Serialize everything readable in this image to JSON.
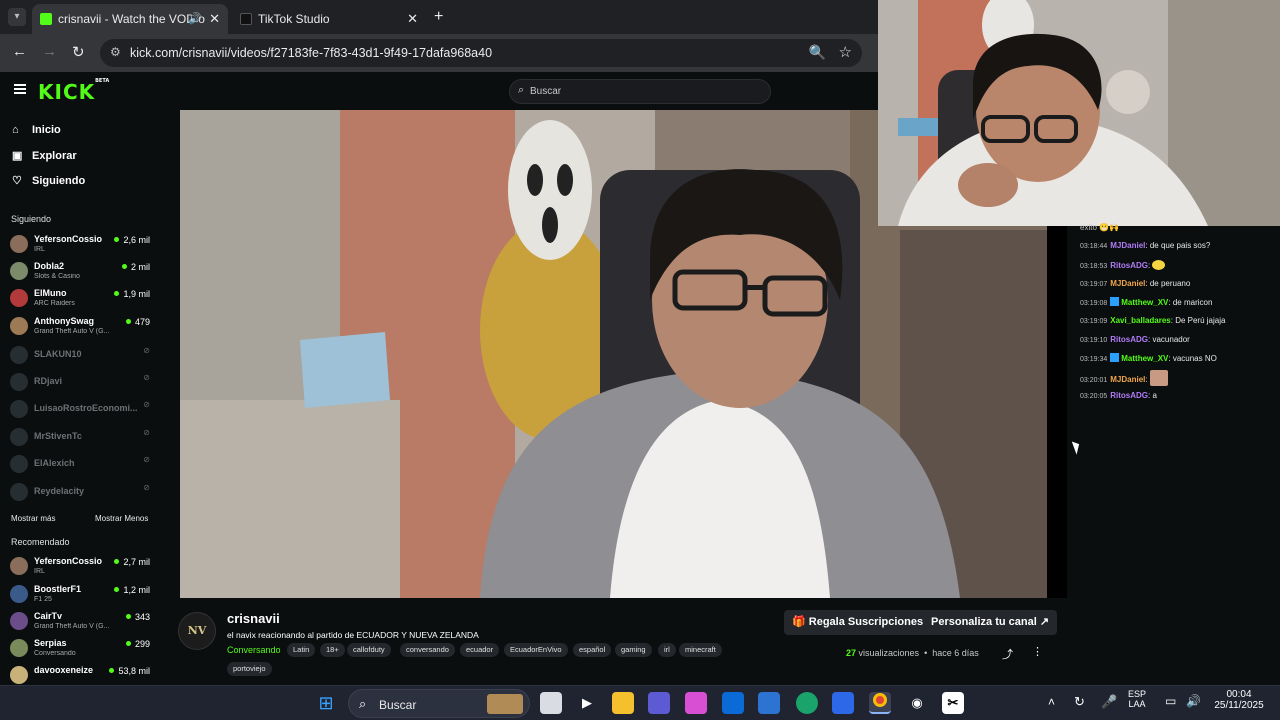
{
  "browser": {
    "tabs": [
      {
        "title": "crisnavii - Watch the VOD o",
        "active": true
      },
      {
        "title": "TikTok Studio",
        "active": false
      }
    ],
    "url": "kick.com/crisnavii/videos/f27183fe-7f83-43d1-9f49-17dafa968a40"
  },
  "header": {
    "logo": "KICK",
    "logo_badge": "BETA",
    "search_placeholder": "Buscar"
  },
  "sidebar": {
    "nav": [
      {
        "label": "Inicio",
        "icon": "home-icon"
      },
      {
        "label": "Explorar",
        "icon": "explore-icon"
      },
      {
        "label": "Siguiendo",
        "icon": "heart-icon"
      }
    ],
    "following_title": "Siguiendo",
    "following": [
      {
        "name": "YefersonCossio",
        "category": "IRL",
        "viewers": "2,6 mil",
        "live": true
      },
      {
        "name": "Dobla2",
        "category": "Slots & Casino",
        "viewers": "2 mil",
        "live": true
      },
      {
        "name": "ElMuno",
        "category": "ARC Raiders",
        "viewers": "1,9 mil",
        "live": true
      },
      {
        "name": "AnthonySwag",
        "category": "Grand Theft Auto V (G...",
        "viewers": "479",
        "live": true
      },
      {
        "name": "SLAKUN10",
        "live": false
      },
      {
        "name": "RDjavi",
        "live": false
      },
      {
        "name": "LuisaoRostroEconomi...",
        "live": false
      },
      {
        "name": "MrStivenTc",
        "live": false
      },
      {
        "name": "ElAlexich",
        "live": false
      },
      {
        "name": "Reydelacity",
        "live": false
      }
    ],
    "show_more": "Mostrar más",
    "show_less": "Mostrar Menos",
    "recommended_title": "Recomendado",
    "recommended": [
      {
        "name": "YefersonCossio",
        "category": "IRL",
        "viewers": "2,7 mil"
      },
      {
        "name": "BoostlerF1",
        "category": "F1 25",
        "viewers": "1,2 mil"
      },
      {
        "name": "CairTv",
        "category": "Grand Theft Auto V (G...",
        "viewers": "343"
      },
      {
        "name": "Serpias",
        "category": "Conversando",
        "viewers": "299"
      },
      {
        "name": "davooxeneize",
        "category": "",
        "viewers": "53,8 mil"
      }
    ]
  },
  "chat": {
    "partial_top": "exito",
    "messages": [
      {
        "time": "03:18:44",
        "user": "MJDaniel",
        "text": "de que pais sos?",
        "color": "#b07cf7"
      },
      {
        "time": "03:18:53",
        "user": "RitosADG",
        "text": "",
        "color": "#b07cf7",
        "emote": true
      },
      {
        "time": "03:19:07",
        "user": "MJDaniel",
        "text": "de peruano",
        "color": "#f2a54a"
      },
      {
        "time": "03:19:08",
        "user": "Matthew_XV",
        "text": "de maricon",
        "color": "#53fc18",
        "badge": true
      },
      {
        "time": "03:19:09",
        "user": "Xavi_balladares",
        "text": "De Perú jajaja",
        "color": "#53fc18"
      },
      {
        "time": "03:19:10",
        "user": "RitosADG",
        "text": "vacunador",
        "color": "#b07cf7"
      },
      {
        "time": "03:19:34",
        "user": "Matthew_XV",
        "text": "vacunas NO",
        "color": "#53fc18",
        "badge": true
      },
      {
        "time": "03:20:01",
        "user": "MJDaniel",
        "text": "",
        "color": "#f2a54a",
        "image": true
      },
      {
        "time": "03:20:05",
        "user": "RitosADG",
        "text": "a",
        "color": "#b07cf7"
      }
    ]
  },
  "stream": {
    "channel": "crisnavii",
    "avatar_text": "NV",
    "title_prefix": "el navix  reacionando al partido  de ",
    "title_bold": "ECUADOR Y NUEVA ZELANDA",
    "category": "Conversando",
    "tags": [
      "Latin",
      "18+",
      "callofduty",
      "conversando",
      "ecuador",
      "EcuadorEnVivo",
      "español",
      "gaming",
      "irl",
      "minecraft",
      "portoviejo"
    ],
    "gift_button": "Regala Suscripciones",
    "customize_button": "Personaliza tu canal",
    "views_count": "27",
    "views_label": "visualizaciones",
    "ago": "hace 6 días"
  },
  "taskbar": {
    "search_placeholder": "Buscar",
    "lang_top": "ESP",
    "lang_bottom": "LAA",
    "time": "00:04",
    "date": "25/11/2025"
  }
}
